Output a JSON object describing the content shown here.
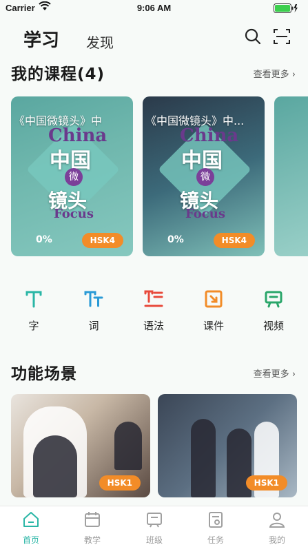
{
  "status_bar": {
    "carrier": "Carrier",
    "time": "9:06 AM"
  },
  "top_tabs": {
    "learn": "学习",
    "discover": "发现"
  },
  "courses_section": {
    "title": "我的课程(4)",
    "see_more": "查看更多",
    "cards": [
      {
        "title": "《中国微镜头》中",
        "progress": "0%",
        "level": "HSK4"
      },
      {
        "title": "《中国微镜头》中...",
        "progress": "0%",
        "level": "HSK4"
      }
    ],
    "cover_text": {
      "china": "China",
      "cn": "中国",
      "wei": "微",
      "jt": "镜头",
      "focus": "Focus"
    }
  },
  "features": [
    {
      "label": "字",
      "icon": "character-icon",
      "color": "#2ab6a6"
    },
    {
      "label": "词",
      "icon": "word-icon",
      "color": "#2a9ad6"
    },
    {
      "label": "语法",
      "icon": "grammar-icon",
      "color": "#e84a3b"
    },
    {
      "label": "课件",
      "icon": "courseware-icon",
      "color": "#f28c28"
    },
    {
      "label": "视频",
      "icon": "video-icon",
      "color": "#2aa66a"
    }
  ],
  "scenes_section": {
    "title": "功能场景",
    "see_more": "查看更多",
    "cards": [
      {
        "level": "HSK1"
      },
      {
        "level": "HSK1"
      }
    ]
  },
  "bottom_nav": [
    {
      "label": "首页",
      "icon": "home-icon",
      "active": true
    },
    {
      "label": "教学",
      "icon": "teach-icon",
      "active": false
    },
    {
      "label": "班级",
      "icon": "class-icon",
      "active": false
    },
    {
      "label": "任务",
      "icon": "task-icon",
      "active": false
    },
    {
      "label": "我的",
      "icon": "profile-icon",
      "active": false
    }
  ],
  "colors": {
    "accent": "#2ab6a6",
    "badge": "#f28c28"
  }
}
